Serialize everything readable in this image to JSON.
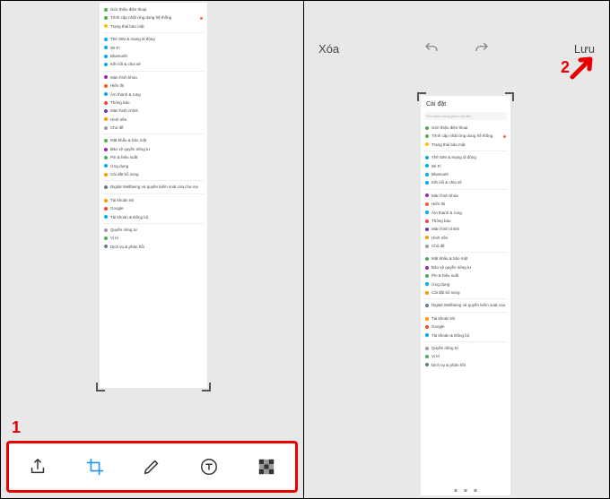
{
  "steps": {
    "one": "1",
    "two": "2"
  },
  "left": {
    "toolbar": {
      "share": "share-icon",
      "crop": "crop-icon",
      "draw": "pencil-icon",
      "text": "text-icon",
      "mosaic": "mosaic-icon"
    },
    "settings": [
      {
        "color": "#4caf50",
        "label": "Giới thiệu điện thoại"
      },
      {
        "color": "#4caf50",
        "label": "Trình cập nhật ứng dung hệ thống",
        "badge": true
      },
      {
        "color": "#ffc107",
        "label": "Trạng thái bảo mật"
      },
      {
        "color": "#03a9f4",
        "label": "Thẻ SIM & mạng di động"
      },
      {
        "color": "#03a9f4",
        "label": "Wi-Fi"
      },
      {
        "color": "#03a9f4",
        "label": "Bluetooth"
      },
      {
        "color": "#03a9f4",
        "label": "Kết nối & chia sẻ"
      },
      {
        "color": "#9c27b0",
        "label": "Màn hình khóa"
      },
      {
        "color": "#ff5722",
        "label": "Hiển thị"
      },
      {
        "color": "#03a9f4",
        "label": "Âm thanh & rung"
      },
      {
        "color": "#f44336",
        "label": "Thông báo"
      },
      {
        "color": "#673ab7",
        "label": "Màn hình chính"
      },
      {
        "color": "#ff9800",
        "label": "Hình nền"
      },
      {
        "color": "#9e9e9e",
        "label": "Chủ đề"
      },
      {
        "color": "#4caf50",
        "label": "Mật khẩu & bảo mật"
      },
      {
        "color": "#9c27b0",
        "label": "Bảo vệ quyền riêng tư"
      },
      {
        "color": "#4caf50",
        "label": "Pin & hiệu suất"
      },
      {
        "color": "#03a9f4",
        "label": "Ứng dụng"
      },
      {
        "color": "#ff9800",
        "label": "Cài đặt bổ sung"
      },
      {
        "color": "#607d8b",
        "label": "Digital Wellbeing và quyền kiểm soát của cha mẹ"
      },
      {
        "color": "#ff9800",
        "label": "Tài khoản Mi"
      },
      {
        "color": "#f44336",
        "label": "Google"
      },
      {
        "color": "#03a9f4",
        "label": "Tài khoản & Đồng bộ"
      },
      {
        "color": "#9e9e9e",
        "label": "Quyền riêng tư"
      },
      {
        "color": "#4caf50",
        "label": "Vị trí"
      },
      {
        "color": "#607d8b",
        "label": "Dịch vụ & phản hồi"
      }
    ]
  },
  "right": {
    "delete_label": "Xóa",
    "save_label": "Lưu",
    "undo": "undo-icon",
    "redo": "redo-icon",
    "preview": {
      "title": "Cài đặt",
      "search_placeholder": "Tìm kiếm trong phần cài đặt"
    },
    "settings": [
      {
        "color": "#4caf50",
        "label": "Giới thiệu điện thoại"
      },
      {
        "color": "#4caf50",
        "label": "Trình cập nhật ứng dung hệ thống",
        "badge": true
      },
      {
        "color": "#ffc107",
        "label": "Trạng thái bảo mật"
      },
      {
        "color": "#03a9f4",
        "label": "Thẻ SIM & mạng di động"
      },
      {
        "color": "#03a9f4",
        "label": "Wi-Fi"
      },
      {
        "color": "#03a9f4",
        "label": "Bluetooth"
      },
      {
        "color": "#03a9f4",
        "label": "Kết nối & chia sẻ"
      },
      {
        "color": "#9c27b0",
        "label": "Màn hình khóa"
      },
      {
        "color": "#ff5722",
        "label": "Hiển thị"
      },
      {
        "color": "#03a9f4",
        "label": "Âm thanh & rung"
      },
      {
        "color": "#f44336",
        "label": "Thông báo"
      },
      {
        "color": "#673ab7",
        "label": "Màn hình chính"
      },
      {
        "color": "#ff9800",
        "label": "Hình nền"
      },
      {
        "color": "#9e9e9e",
        "label": "Chủ đề"
      },
      {
        "color": "#4caf50",
        "label": "Mật khẩu & bảo mật"
      },
      {
        "color": "#9c27b0",
        "label": "Bảo vệ quyền riêng tư"
      },
      {
        "color": "#4caf50",
        "label": "Pin & hiệu suất"
      },
      {
        "color": "#03a9f4",
        "label": "Ứng dụng"
      },
      {
        "color": "#ff9800",
        "label": "Cài đặt bổ sung"
      },
      {
        "color": "#607d8b",
        "label": "Digital Wellbeing và quyền kiểm soát của cha mẹ"
      },
      {
        "color": "#ff9800",
        "label": "Tài khoản Mi"
      },
      {
        "color": "#f44336",
        "label": "Google"
      },
      {
        "color": "#03a9f4",
        "label": "Tài khoản & Đồng bộ"
      },
      {
        "color": "#9e9e9e",
        "label": "Quyền riêng tư"
      },
      {
        "color": "#4caf50",
        "label": "Vị trí"
      },
      {
        "color": "#607d8b",
        "label": "Dịch vụ & phản hồi"
      }
    ]
  }
}
